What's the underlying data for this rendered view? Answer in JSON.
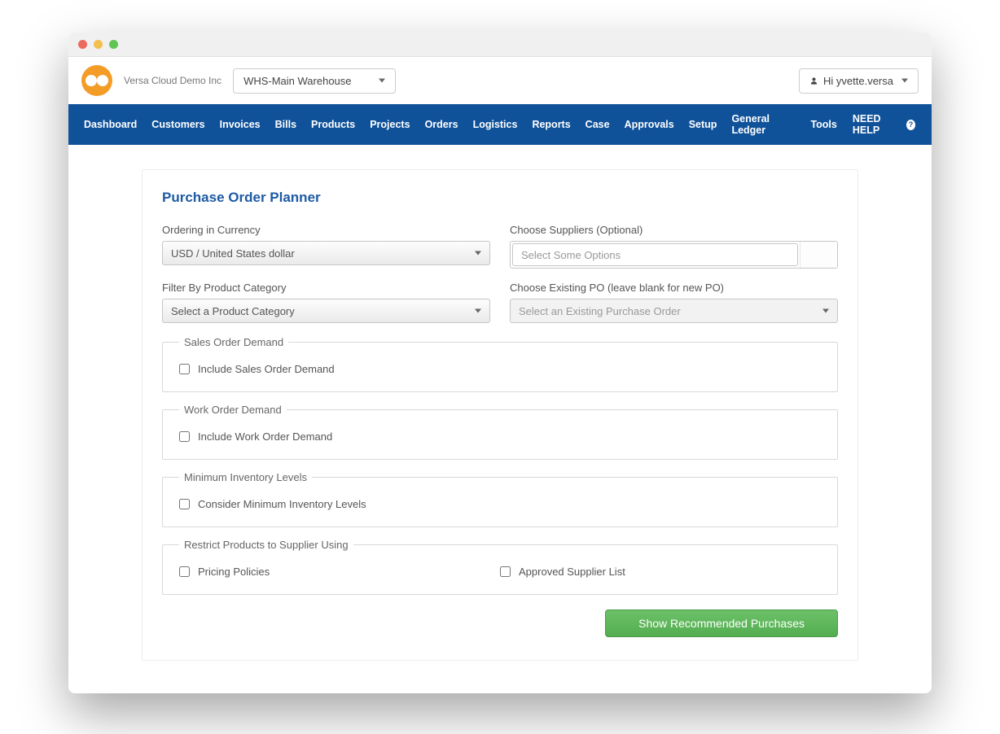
{
  "header": {
    "company": "Versa Cloud Demo Inc",
    "warehouse": "WHS-Main Warehouse",
    "user": "Hi yvette.versa"
  },
  "nav": {
    "items": [
      "Dashboard",
      "Customers",
      "Invoices",
      "Bills",
      "Products",
      "Projects",
      "Orders",
      "Logistics",
      "Reports",
      "Case",
      "Approvals",
      "Setup",
      "General Ledger",
      "Tools"
    ],
    "help": "NEED HELP"
  },
  "panel": {
    "title": "Purchase Order Planner",
    "currency_label": "Ordering in Currency",
    "currency_value": "USD / United States dollar",
    "suppliers_label": "Choose Suppliers (Optional)",
    "suppliers_placeholder": "Select Some Options",
    "category_label": "Filter By Product Category",
    "category_value": "Select a Product Category",
    "existing_po_label": "Choose Existing PO (leave blank for new PO)",
    "existing_po_value": "Select an Existing Purchase Order",
    "fs_sales": "Sales Order Demand",
    "cb_sales": "Include Sales Order Demand",
    "fs_work": "Work Order Demand",
    "cb_work": "Include Work Order Demand",
    "fs_inventory": "Minimum Inventory Levels",
    "cb_inventory": "Consider Minimum Inventory Levels",
    "fs_restrict": "Restrict Products to Supplier Using",
    "cb_pricing": "Pricing Policies",
    "cb_approved": "Approved Supplier List",
    "action": "Show Recommended Purchases"
  }
}
